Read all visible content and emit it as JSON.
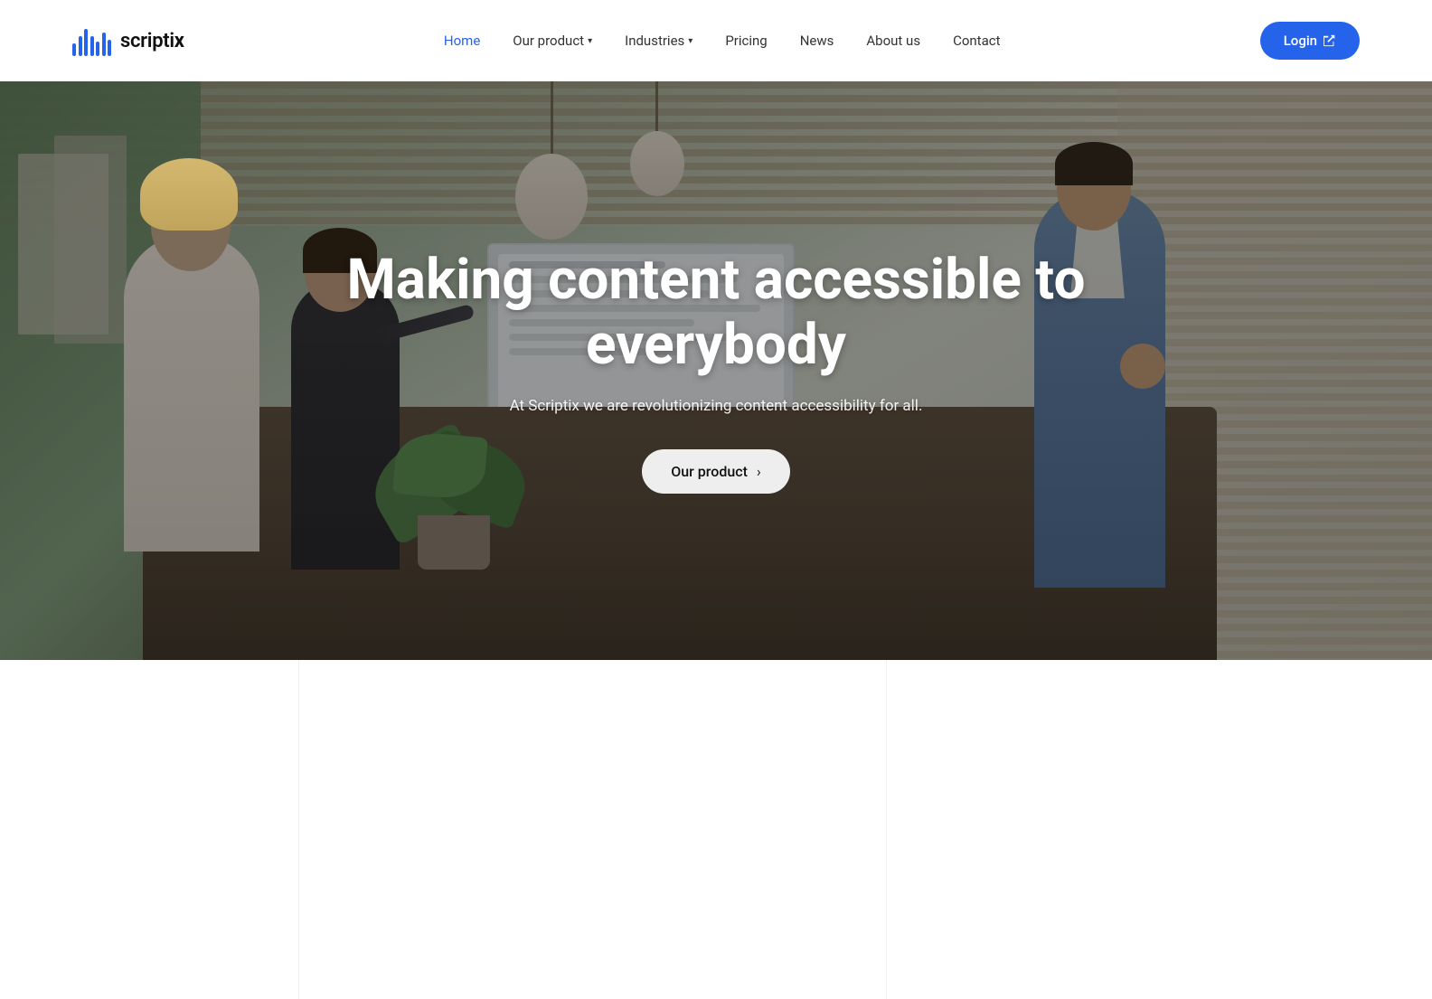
{
  "brand": {
    "name_prefix": "scripti",
    "name_suffix": "x",
    "full_name": "scriptix"
  },
  "nav": {
    "items": [
      {
        "id": "home",
        "label": "Home",
        "active": true,
        "has_dropdown": false
      },
      {
        "id": "our-product",
        "label": "Our product",
        "active": false,
        "has_dropdown": true
      },
      {
        "id": "industries",
        "label": "Industries",
        "active": false,
        "has_dropdown": true
      },
      {
        "id": "pricing",
        "label": "Pricing",
        "active": false,
        "has_dropdown": false
      },
      {
        "id": "news",
        "label": "News",
        "active": false,
        "has_dropdown": false
      },
      {
        "id": "about-us",
        "label": "About us",
        "active": false,
        "has_dropdown": false
      },
      {
        "id": "contact",
        "label": "Contact",
        "active": false,
        "has_dropdown": false
      }
    ],
    "login_label": "Login"
  },
  "hero": {
    "title": "Making content accessible to everybody",
    "subtitle": "At Scriptix we are revolutionizing content accessibility for all.",
    "cta_label": "Our product"
  },
  "colors": {
    "accent": "#2563eb",
    "text_dark": "#111111",
    "text_nav": "#333333",
    "hero_bg_overlay": "rgba(20,20,20,0.42)"
  }
}
